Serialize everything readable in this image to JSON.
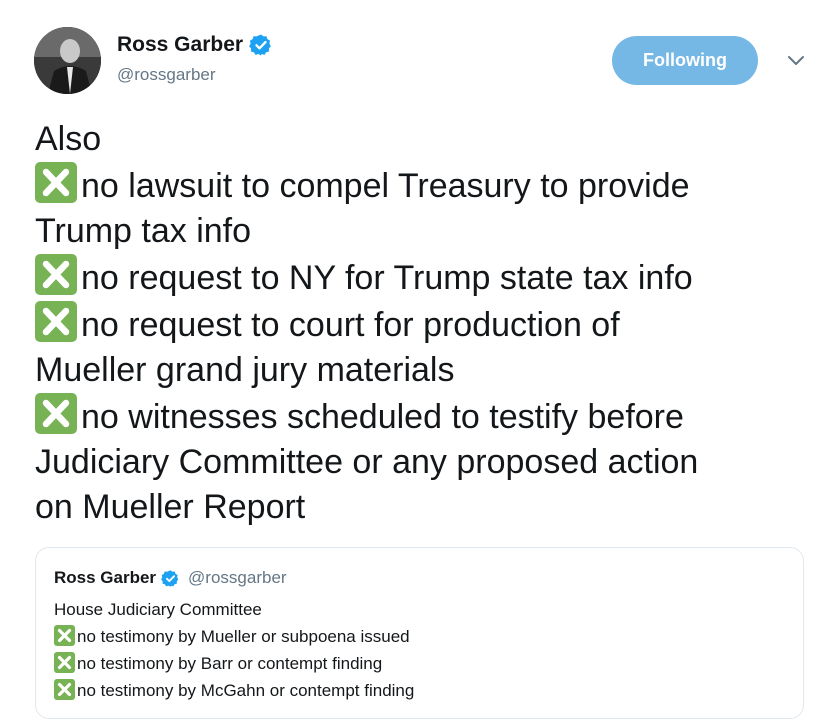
{
  "colors": {
    "follow_button_bg": "#75b7e5",
    "verified_blue": "#1da1f2",
    "cross_mark_green": "#77b255",
    "handle_gray": "#657786"
  },
  "author": {
    "display_name": "Ross Garber",
    "handle": "@rossgarber",
    "verified_icon": "verified-badge-icon",
    "avatar_icon": "profile-photo"
  },
  "actions": {
    "follow_label": "Following",
    "more_icon": "chevron-down-icon"
  },
  "tweet": {
    "mark_icon": "cross-mark-button-emoji",
    "intro": "Also",
    "items": [
      {
        "lines": [
          "no lawsuit to compel Treasury to provide",
          "Trump tax info"
        ]
      },
      {
        "lines": [
          "no request to NY for Trump state tax info"
        ]
      },
      {
        "lines": [
          "no request to court for production of",
          "Mueller grand jury materials"
        ]
      },
      {
        "lines": [
          "no witnesses scheduled to testify before",
          "Judiciary Committee or any proposed action",
          "on Mueller Report"
        ]
      }
    ]
  },
  "quoted_tweet": {
    "display_name": "Ross Garber",
    "handle": "@rossgarber",
    "heading": "House Judiciary Committee",
    "items": [
      "no testimony by Mueller or subpoena issued",
      "no testimony by Barr or contempt finding",
      "no testimony by McGahn or contempt finding"
    ]
  }
}
